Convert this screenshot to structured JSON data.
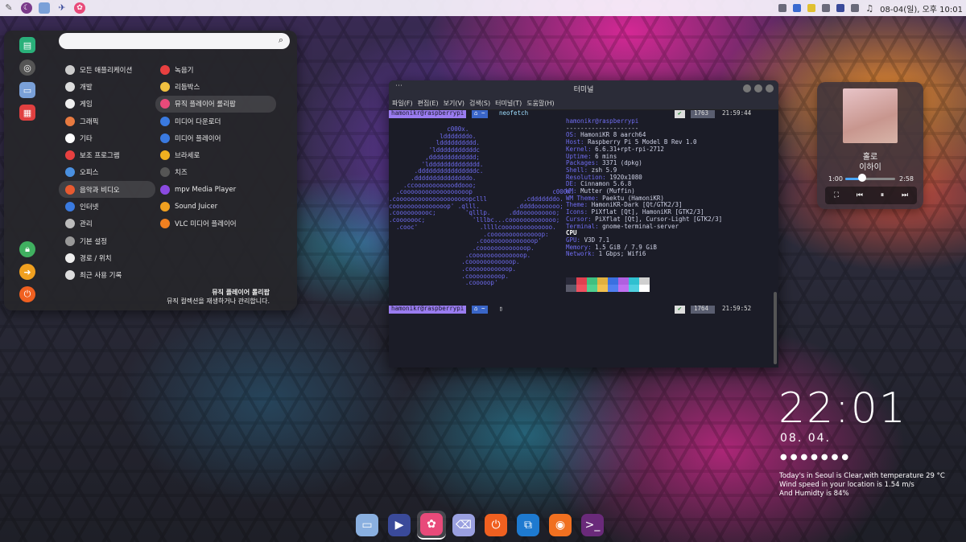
{
  "topbar": {
    "datetime": "08-04(일), 오후 10:01",
    "icons": [
      "pencil-icon",
      "moon-icon",
      "files-icon",
      "satellite-icon",
      "pinwheel-icon"
    ],
    "tray": [
      "network-icon",
      "bluetooth-icon",
      "notes-icon",
      "clipboard-icon",
      "volume-icon",
      "music-icon"
    ]
  },
  "menu": {
    "search_placeholder": "",
    "categories": [
      {
        "label": "모든 애플리케이션",
        "icon": "grid-icon",
        "color": "#cccccc"
      },
      {
        "label": "개발",
        "icon": "dev-icon",
        "color": "#dddddd"
      },
      {
        "label": "게임",
        "icon": "game-icon",
        "color": "#eeeeee"
      },
      {
        "label": "그래픽",
        "icon": "graphics-icon",
        "color": "#e87a40"
      },
      {
        "label": "기타",
        "icon": "other-icon",
        "color": "#ffffff"
      },
      {
        "label": "보조 프로그램",
        "icon": "accessory-icon",
        "color": "#e84040"
      },
      {
        "label": "오피스",
        "icon": "office-icon",
        "color": "#4a90e0"
      },
      {
        "label": "음악과 비디오",
        "icon": "media-icon",
        "color": "#e85a30"
      },
      {
        "label": "인터넷",
        "icon": "internet-icon",
        "color": "#3a7ae0"
      },
      {
        "label": "관리",
        "icon": "admin-icon",
        "color": "#bbbbbb"
      },
      {
        "label": "기본 설정",
        "icon": "settings-icon",
        "color": "#999999"
      },
      {
        "label": "경로 / 위치",
        "icon": "places-icon",
        "color": "#eeeeee"
      },
      {
        "label": "최근 사용 기록",
        "icon": "recent-icon",
        "color": "#dddddd"
      }
    ],
    "apps": [
      {
        "label": "녹음기",
        "color": "#e84040"
      },
      {
        "label": "리듬박스",
        "color": "#f0c040"
      },
      {
        "label": "뮤직 플레이어 롤리팝",
        "color": "#e84a7a"
      },
      {
        "label": "미디어 다운로더",
        "color": "#3a7ae0"
      },
      {
        "label": "미디어 플레이어",
        "color": "#3a7ae0"
      },
      {
        "label": "브라세로",
        "color": "#f0b020"
      },
      {
        "label": "치즈",
        "color": "#555555"
      },
      {
        "label": "mpv Media Player",
        "color": "#8a4ae0"
      },
      {
        "label": "Sound Juicer",
        "color": "#f0a020"
      },
      {
        "label": "VLC 미디어 플레이어",
        "color": "#f08020"
      }
    ],
    "desc_title": "뮤직 플레이어 롤리팝",
    "desc_text": "뮤직 컬렉션을 재생하거나 관리합니다.",
    "side_icons": [
      "app-store-icon",
      "system-icon",
      "files-icon",
      "calendar-icon",
      "lock-icon",
      "logout-icon",
      "power-icon"
    ]
  },
  "terminal": {
    "title": "터미널",
    "menu": [
      "파일(F)",
      "편집(E)",
      "보기(V)",
      "검색(S)",
      "터미널(T)",
      "도움말(H)"
    ],
    "prompt_user": "hamonikr@raspberrypi",
    "prompt_dir": "⌂ ~",
    "command": "neofetch",
    "status1_num": "1763",
    "status1_time": "21:59:44",
    "status2_num": "1764",
    "status2_time": "21:59:52",
    "logo": "                c000x.\n              ldddddddo.\n             ldddddddddd.\n           'ldddddddddddc\n          ,ddddddddddddd;\n         'ldddddddddddddd.\n       .ddddddddddddddddc.\n      .dddddddddddddddo.\n    .ccoooooooooooddooo;\n  .coooooooooooooooooop                      c000x.\n.coooooooooooooooooooopclll          .cdddddddo.\ncooooooooooooooop' .qlll.          .ddddooooooo;\n.coooooooooc;        'qlllp.     .ddoooooooooo;\n.cooooooc;             'lllbc...cooooooooooooo;\n  .cooc'                 .llllcoooooooooooooo.\n                          .coooooooooooooop:\n                        .coooooooooooooop'\n                       .cooooooooooooop.\n                     .coooooooooooooop.\n                    .coooooooooooop.\n                    .cooooooooooop.\n                    .cooooooooop.\n                     .cooooop'",
    "info": [
      [
        "",
        "hamonikr@raspberrypi"
      ],
      [
        "",
        "--------------------"
      ],
      [
        "OS: ",
        "HamoniKR 8 aarch64"
      ],
      [
        "Host: ",
        "Raspberry Pi 5 Model B Rev 1.0"
      ],
      [
        "Kernel: ",
        "6.6.31+rpt-rpi-2712"
      ],
      [
        "Uptime: ",
        "6 mins"
      ],
      [
        "Packages: ",
        "3371 (dpkg)"
      ],
      [
        "Shell: ",
        "zsh 5.9"
      ],
      [
        "Resolution: ",
        "1920x1080"
      ],
      [
        "DE: ",
        "Cinnamon 5.6.8"
      ],
      [
        "WM: ",
        "Mutter (Muffin)"
      ],
      [
        "WM Theme: ",
        "Paektu (HamoniKR)"
      ],
      [
        "Theme: ",
        "HamoniKR-Dark [Qt/GTK2/3]"
      ],
      [
        "Icons: ",
        "PiXflat [Qt], HamoniKR [GTK2/3]"
      ],
      [
        "Cursor: ",
        "PiXflat [Qt], Cursor-Light [GTK2/3]"
      ],
      [
        "Terminal: ",
        "gnome-terminal-server"
      ],
      [
        "",
        "CPU"
      ],
      [
        "GPU: ",
        "V3D 7.1"
      ],
      [
        "Memory: ",
        "1.5 GiB / 7.9 GiB"
      ],
      [
        "Network: ",
        "1 Gbps; Wifi6"
      ]
    ],
    "palette": [
      "#2a2a3a",
      "#e04050",
      "#40c080",
      "#e0b040",
      "#3a70e0",
      "#b060e0",
      "#30c0d0",
      "#d0d0d0",
      "#5a5a6a",
      "#f05060",
      "#50d090",
      "#f0c050",
      "#5080f0",
      "#c070f0",
      "#50d0e0",
      "#ffffff"
    ]
  },
  "music": {
    "song": "홀로",
    "artist": "이하이",
    "current": "1:00",
    "total": "2:58",
    "progress": 0.34
  },
  "desktop_clock": {
    "time": "22:01",
    "date": "08. 04.",
    "dots": "●●●●●●●",
    "weather": [
      "Today's in Seoul is Clear,with temperature 29 °C",
      "Wind speed in your location is 1.54 m/s",
      "And Humidty is 84%"
    ]
  },
  "dock": [
    {
      "name": "files-icon",
      "color": "#8ab0e0",
      "glyph": "▭"
    },
    {
      "name": "video-player-icon",
      "color": "#3a4a9a",
      "glyph": "▶"
    },
    {
      "name": "music-lollypop-icon",
      "color": "#e84a7a",
      "glyph": "✿"
    },
    {
      "name": "trash-icon",
      "color": "#9aa0e0",
      "glyph": "⌫"
    },
    {
      "name": "power-icon",
      "color": "#f06020",
      "glyph": "⏻"
    },
    {
      "name": "vscode-icon",
      "color": "#1e7ad0",
      "glyph": "⧉"
    },
    {
      "name": "firefox-icon",
      "color": "#f07020",
      "glyph": "◉"
    },
    {
      "name": "terminal-icon",
      "color": "#6a2a7a",
      "glyph": ">_"
    }
  ]
}
